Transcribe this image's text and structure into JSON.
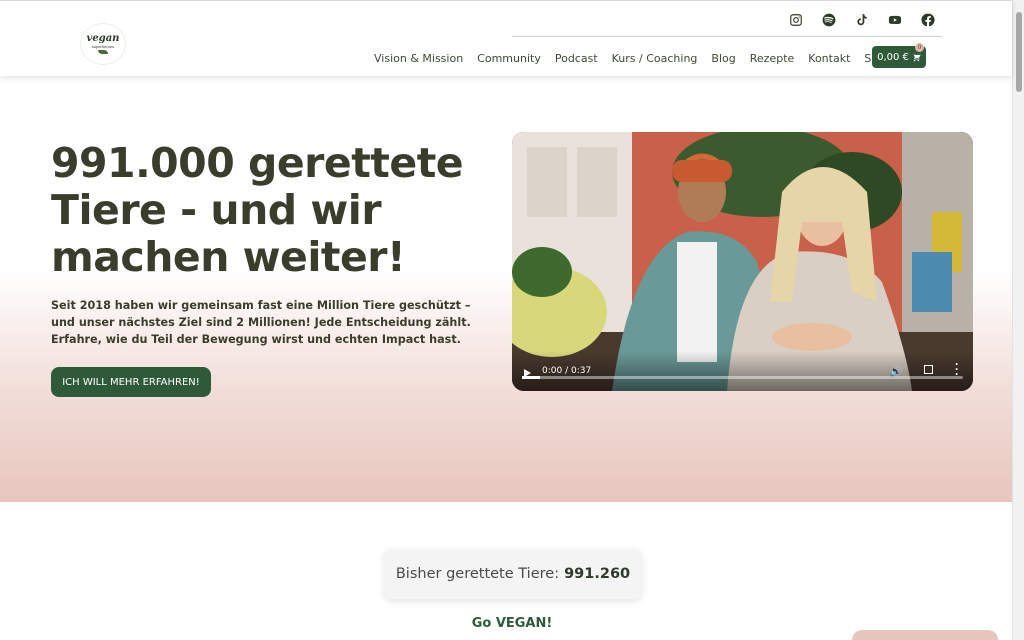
{
  "header": {
    "logo": {
      "line1": "vegan",
      "line2": "superheroes"
    },
    "social": [
      {
        "name": "instagram-icon"
      },
      {
        "name": "spotify-icon"
      },
      {
        "name": "tiktok-icon"
      },
      {
        "name": "youtube-icon"
      },
      {
        "name": "facebook-icon"
      }
    ],
    "nav": [
      {
        "label": "Vision & Mission"
      },
      {
        "label": "Community"
      },
      {
        "label": "Podcast"
      },
      {
        "label": "Kurs / Coaching"
      },
      {
        "label": "Blog"
      },
      {
        "label": "Rezepte"
      },
      {
        "label": "Kontakt"
      },
      {
        "label": "Shop"
      }
    ],
    "cart": {
      "label": "0,00 €",
      "count": "0"
    }
  },
  "hero": {
    "title": "991.000 gerettete Tiere - und wir machen weiter!",
    "text": "Seit 2018 haben wir gemeinsam fast eine Million Tiere geschützt – und unser nächstes Ziel sind 2 Millionen! Jede Entscheidung zählt. Erfahre, wie du Teil der Bewegung wirst und echten Impact hast.",
    "cta": "ICH WILL MEHR ERFAHREN!",
    "video": {
      "time": "0:00 / 0:37",
      "progress": 0.04
    }
  },
  "counter": {
    "label": "Bisher gerettete Tiere:",
    "value": "991.260"
  },
  "section": {
    "heading": "Go VEGAN!"
  },
  "colors": {
    "brand": "#2f5a3a",
    "text": "#3b3d2c",
    "blush": "#e7c6bd"
  }
}
